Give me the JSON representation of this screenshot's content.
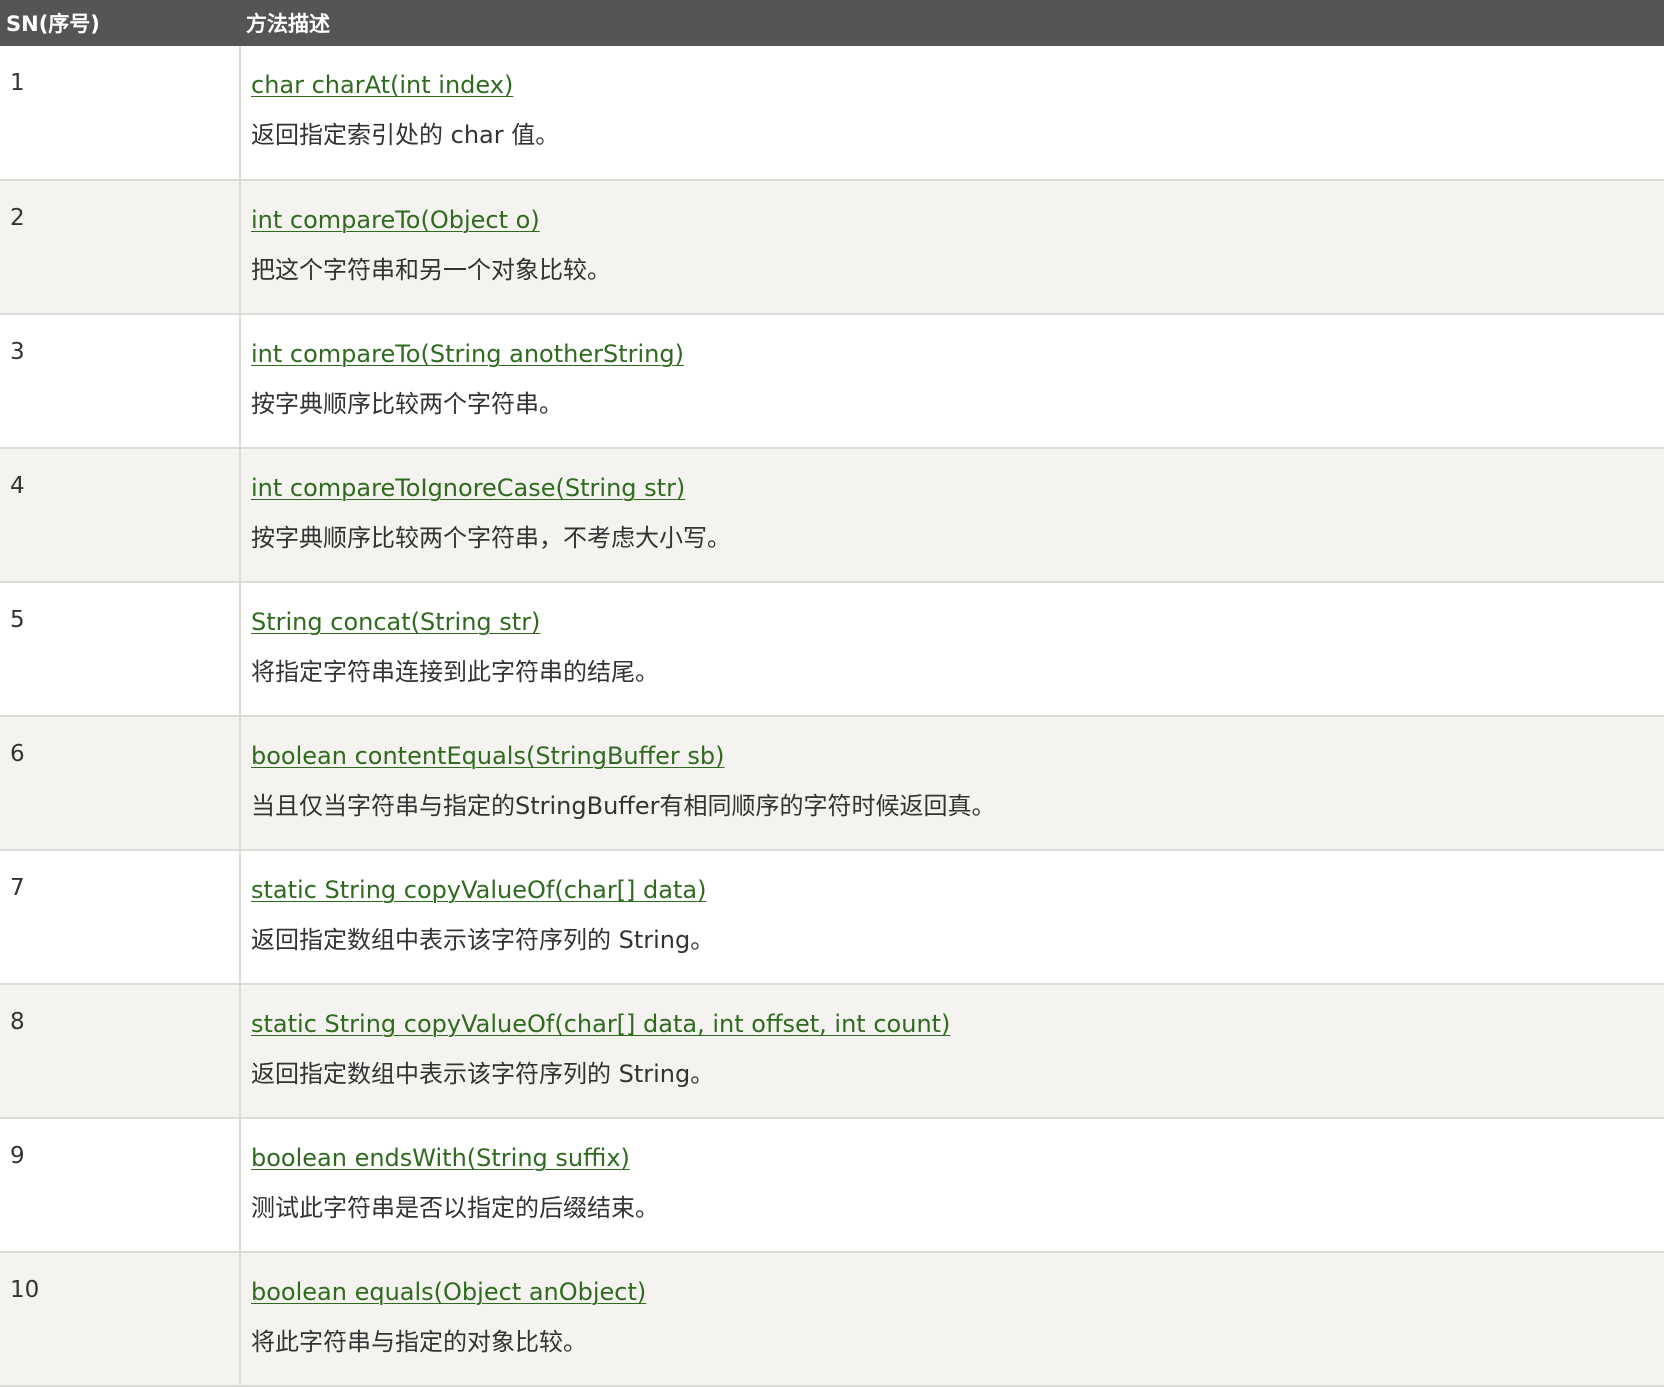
{
  "table": {
    "headers": {
      "sn": "SN(序号)",
      "desc": "方法描述"
    },
    "rows": [
      {
        "sn": "1",
        "method": "char charAt(int index)",
        "desc": "返回指定索引处的 char 值。"
      },
      {
        "sn": "2",
        "method": "int compareTo(Object o)",
        "desc": "把这个字符串和另一个对象比较。"
      },
      {
        "sn": "3",
        "method": "int compareTo(String anotherString)",
        "desc": "按字典顺序比较两个字符串。"
      },
      {
        "sn": "4",
        "method": "int compareToIgnoreCase(String str)",
        "desc": "按字典顺序比较两个字符串，不考虑大小写。"
      },
      {
        "sn": "5",
        "method": "String concat(String str)",
        "desc": "将指定字符串连接到此字符串的结尾。"
      },
      {
        "sn": "6",
        "method": "boolean contentEquals(StringBuffer sb)",
        "desc": "当且仅当字符串与指定的StringBuffer有相同顺序的字符时候返回真。"
      },
      {
        "sn": "7",
        "method": "static String copyValueOf(char[] data)",
        "desc": "返回指定数组中表示该字符序列的 String。"
      },
      {
        "sn": "8",
        "method": "static String copyValueOf(char[] data, int offset, int count)",
        "desc": "返回指定数组中表示该字符序列的 String。"
      },
      {
        "sn": "9",
        "method": "boolean endsWith(String suffix)",
        "desc": "测试此字符串是否以指定的后缀结束。"
      },
      {
        "sn": "10",
        "method": "boolean equals(Object anObject)",
        "desc": "将此字符串与指定的对象比较。"
      }
    ]
  },
  "colors": {
    "header_bg": "#555555",
    "link": "#2f6b1f",
    "row_alt_bg": "#f4f3ef"
  }
}
